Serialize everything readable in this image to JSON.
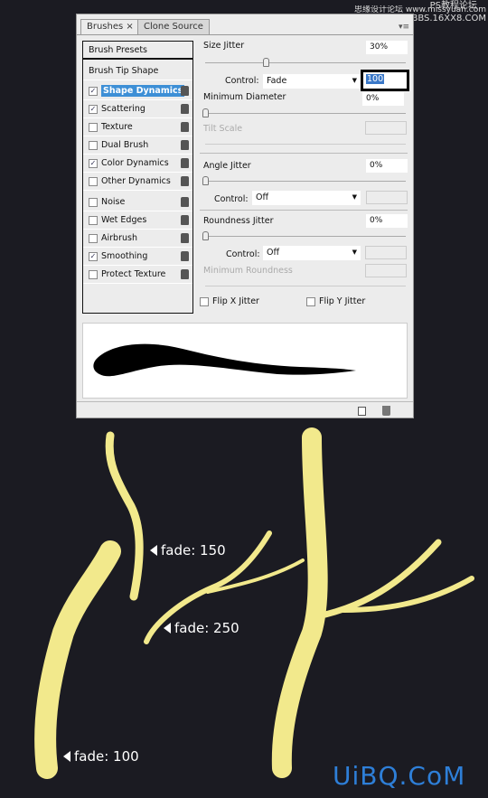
{
  "watermark_top": {
    "line1": "思缘设计论坛 www.missyuan.com",
    "line2": "PS教程论坛",
    "line3": "BBS.16XX8.COM"
  },
  "tabs": [
    {
      "label": "Brushes ×",
      "active": true
    },
    {
      "label": "Clone Source",
      "active": false
    }
  ],
  "list": {
    "presets": "Brush Presets",
    "tip": "Brush Tip Shape",
    "items": [
      {
        "label": "Shape Dynamics",
        "checked": true,
        "selected": true
      },
      {
        "label": "Scattering",
        "checked": true
      },
      {
        "label": "Texture",
        "checked": false
      },
      {
        "label": "Dual Brush",
        "checked": false
      },
      {
        "label": "Color Dynamics",
        "checked": true
      },
      {
        "label": "Other Dynamics",
        "checked": false
      },
      {
        "label": "Noise",
        "checked": false
      },
      {
        "label": "Wet Edges",
        "checked": false
      },
      {
        "label": "Airbrush",
        "checked": false
      },
      {
        "label": "Smoothing",
        "checked": true
      },
      {
        "label": "Protect Texture",
        "checked": false
      }
    ]
  },
  "settings": {
    "size_jitter": "Size Jitter",
    "size_jitter_val": "30%",
    "size_jitter_pct": 30,
    "control": "Control:",
    "control1": "Fade",
    "fade_val": "100",
    "min_diameter": "Minimum Diameter",
    "min_diameter_val": "0%",
    "tilt_scale": "Tilt Scale",
    "angle_jitter": "Angle Jitter",
    "angle_jitter_val": "0%",
    "control2": "Off",
    "roundness_jitter": "Roundness Jitter",
    "roundness_jitter_val": "0%",
    "control3": "Off",
    "min_roundness": "Minimum Roundness",
    "flip_x": "Flip X Jitter",
    "flip_y": "Flip Y Jitter"
  },
  "annotations": {
    "a150": "fade: 150",
    "a250": "fade: 250",
    "a100": "fade: 100"
  },
  "watermark_bottom": "UiBQ.CoM",
  "colors": {
    "stroke": "#f2e98c",
    "accent": "#3d8fd6",
    "watermark": "#2e7fd8"
  }
}
